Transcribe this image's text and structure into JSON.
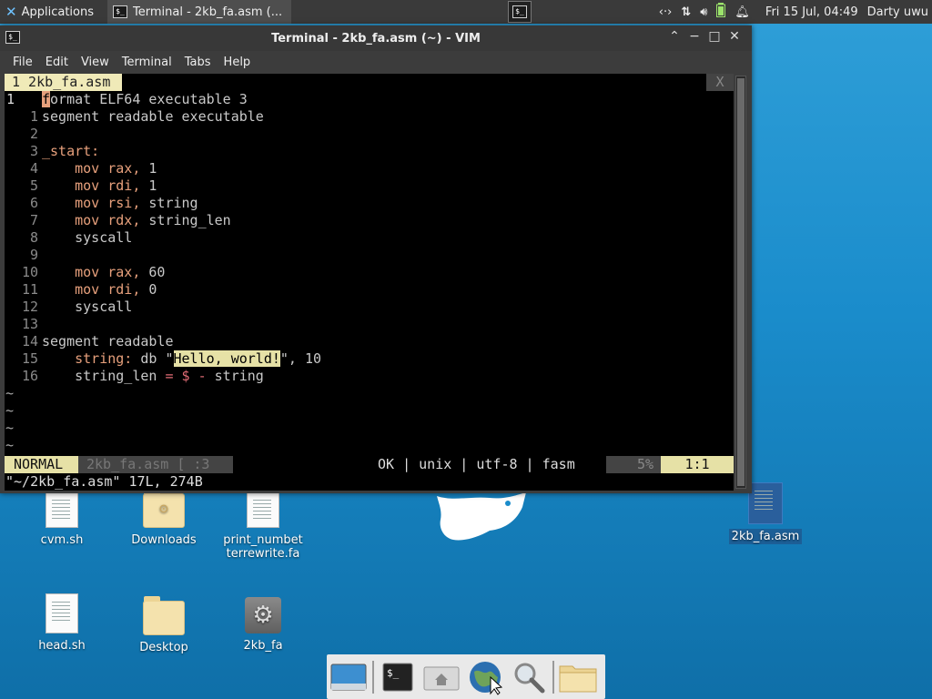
{
  "top_panel": {
    "applications_label": "Applications",
    "task_label": "Terminal - 2kb_fa.asm (...",
    "clock": "Fri 15 Jul, 04:49",
    "user": "Darty uwu"
  },
  "window": {
    "title": "Terminal - 2kb_fa.asm (~) - VIM",
    "menu": [
      "File",
      "Edit",
      "View",
      "Terminal",
      "Tabs",
      "Help"
    ]
  },
  "vim": {
    "tab_label": "1 2kb_fa.asm",
    "tab_close": "X",
    "lines": [
      {
        "num": "1",
        "segs": [
          [
            "cursor",
            "f"
          ],
          [
            "",
            "ormat ELF64 executable 3"
          ]
        ]
      },
      {
        "num": "1",
        "segs": [
          [
            "",
            "segment readable executable"
          ]
        ]
      },
      {
        "num": "2",
        "segs": []
      },
      {
        "num": "3",
        "segs": [
          [
            "kw",
            "_start:"
          ]
        ]
      },
      {
        "num": "4",
        "segs": [
          [
            "",
            "    "
          ],
          [
            "kw",
            "mov rax,"
          ],
          [
            "",
            " 1"
          ]
        ]
      },
      {
        "num": "5",
        "segs": [
          [
            "",
            "    "
          ],
          [
            "kw",
            "mov rdi,"
          ],
          [
            "",
            " 1"
          ]
        ]
      },
      {
        "num": "6",
        "segs": [
          [
            "",
            "    "
          ],
          [
            "kw",
            "mov rsi,"
          ],
          [
            "",
            " string"
          ]
        ]
      },
      {
        "num": "7",
        "segs": [
          [
            "",
            "    "
          ],
          [
            "kw",
            "mov rdx,"
          ],
          [
            "",
            " string_len"
          ]
        ]
      },
      {
        "num": "8",
        "segs": [
          [
            "",
            "    syscall"
          ]
        ]
      },
      {
        "num": "9",
        "segs": []
      },
      {
        "num": "10",
        "segs": [
          [
            "",
            "    "
          ],
          [
            "kw",
            "mov rax,"
          ],
          [
            "",
            " 60"
          ]
        ]
      },
      {
        "num": "11",
        "segs": [
          [
            "",
            "    "
          ],
          [
            "kw",
            "mov rdi,"
          ],
          [
            "",
            " 0"
          ]
        ]
      },
      {
        "num": "12",
        "segs": [
          [
            "",
            "    syscall"
          ]
        ]
      },
      {
        "num": "13",
        "segs": []
      },
      {
        "num": "14",
        "segs": [
          [
            "",
            "segment readable"
          ]
        ]
      },
      {
        "num": "15",
        "segs": [
          [
            "",
            "    "
          ],
          [
            "kw",
            "string:"
          ],
          [
            "",
            " db \""
          ],
          [
            "hl",
            "Hello, world!"
          ],
          [
            "",
            "\", 10"
          ]
        ]
      },
      {
        "num": "16",
        "segs": [
          [
            "",
            "    string_len "
          ],
          [
            "op",
            "="
          ],
          [
            "",
            " "
          ],
          [
            "op",
            "$"
          ],
          [
            "",
            " "
          ],
          [
            "op",
            "-"
          ],
          [
            "",
            " string"
          ]
        ]
      }
    ],
    "tilde": "~",
    "tilde_count": 4,
    "mode": "NORMAL",
    "status_file": "2kb_fa.asm [ :3",
    "status_info": "OK | unix | utf-8 | fasm",
    "status_pct": "5%",
    "status_pos": "1:1",
    "cmdline": "\"~/2kb_fa.asm\" 17L, 274B"
  },
  "desktop": {
    "icons": [
      {
        "name": "cvm-sh",
        "label": "cvm.sh"
      },
      {
        "name": "downloads",
        "label": "Downloads"
      },
      {
        "name": "print-numbet",
        "label": "print_numbet terrewrite.fa"
      },
      {
        "name": "2kb-fa-asm",
        "label": "2kb_fa.asm"
      },
      {
        "name": "head-sh",
        "label": "head.sh"
      },
      {
        "name": "desktop",
        "label": "Desktop"
      },
      {
        "name": "2kb-fa",
        "label": "2kb_fa"
      }
    ]
  },
  "colors": {
    "desktop_bg": "#1a8ccb",
    "vim_keyword": "#e7a07c",
    "vim_highlight": "#e6e1a6",
    "panel_bg": "#3a3a3a"
  }
}
